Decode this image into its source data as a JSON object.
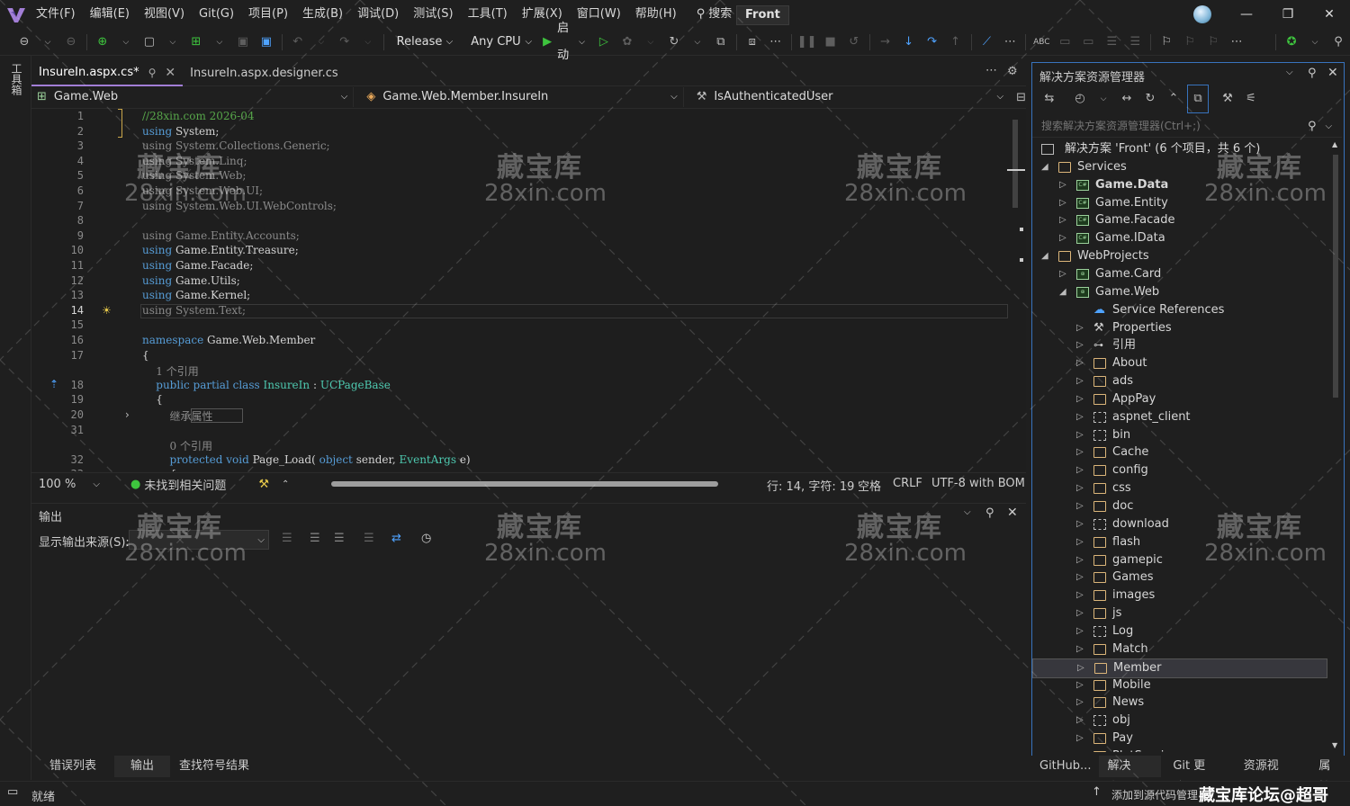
{
  "menubar": {
    "items": [
      "文件(F)",
      "编辑(E)",
      "视图(V)",
      "Git(G)",
      "项目(P)",
      "生成(B)",
      "调试(D)",
      "测试(S)",
      "工具(T)",
      "扩展(X)",
      "窗口(W)",
      "帮助(H)"
    ],
    "search_label": "搜索",
    "solution_name": "Front"
  },
  "toolbar": {
    "config": "Release",
    "platform": "Any CPU",
    "start_label": "启动"
  },
  "leftstrip": {
    "toolbox_label": "工具箱"
  },
  "doc_tabs": [
    {
      "label": "InsureIn.aspx.cs*",
      "active": true
    },
    {
      "label": "InsureIn.aspx.designer.cs",
      "active": false
    }
  ],
  "navbar": {
    "project": "Game.Web",
    "class": "Game.Web.Member.InsureIn",
    "member": "IsAuthenticatedUser"
  },
  "editor": {
    "lines": [
      {
        "n": "1",
        "segs": [
          [
            "cm",
            "//28xin.com 2026-04"
          ]
        ]
      },
      {
        "n": "2",
        "segs": [
          [
            "kw",
            "using"
          ],
          [
            "",
            "System;"
          ]
        ]
      },
      {
        "n": "3",
        "segs": [
          [
            "gr",
            "using"
          ],
          [
            "gr",
            "System.Collections.Generic;"
          ]
        ]
      },
      {
        "n": "4",
        "segs": [
          [
            "gr",
            "using"
          ],
          [
            "gr",
            "System.Linq;"
          ]
        ]
      },
      {
        "n": "5",
        "segs": [
          [
            "gr",
            "using"
          ],
          [
            "gr",
            "System.Web;"
          ]
        ]
      },
      {
        "n": "6",
        "segs": [
          [
            "gr",
            "using"
          ],
          [
            "gr",
            "System.Web.UI;"
          ]
        ]
      },
      {
        "n": "7",
        "segs": [
          [
            "gr",
            "using"
          ],
          [
            "gr",
            "System.Web.UI.WebControls;"
          ]
        ]
      },
      {
        "n": "8",
        "segs": []
      },
      {
        "n": "9",
        "segs": [
          [
            "gr",
            "using"
          ],
          [
            "gr",
            "Game.Entity.Accounts;"
          ]
        ]
      },
      {
        "n": "10",
        "segs": [
          [
            "kw",
            "using"
          ],
          [
            "",
            "Game.Entity.Treasure;"
          ]
        ]
      },
      {
        "n": "11",
        "segs": [
          [
            "kw",
            "using"
          ],
          [
            "",
            "Game.Facade;"
          ]
        ]
      },
      {
        "n": "12",
        "segs": [
          [
            "kw",
            "using"
          ],
          [
            "",
            "Game.Utils;"
          ]
        ]
      },
      {
        "n": "13",
        "segs": [
          [
            "kw",
            "using"
          ],
          [
            "",
            "Game.Kernel;"
          ]
        ]
      },
      {
        "n": "14",
        "segs": [
          [
            "gr",
            "using"
          ],
          [
            "gr",
            "System.Text;"
          ]
        ]
      },
      {
        "n": "15",
        "segs": []
      },
      {
        "n": "16",
        "segs": [
          [
            "kw",
            "namespace"
          ],
          [
            "",
            "Game.Web.Member"
          ]
        ]
      },
      {
        "n": "17",
        "segs": [
          [
            "",
            "{"
          ]
        ]
      },
      {
        "n": "",
        "segs": [
          [
            "gr",
            "    1 个引用"
          ]
        ]
      },
      {
        "n": "18",
        "segs": [
          [
            "kw",
            "    public partial class"
          ],
          [
            "ty",
            "InsureIn"
          ],
          [
            "",
            ":"
          ],
          [
            "ty",
            "UCPageBase"
          ]
        ]
      },
      {
        "n": "19",
        "segs": [
          [
            "",
            "    {"
          ]
        ]
      },
      {
        "n": "20",
        "segs": [
          [
            "gr",
            "        继承属性"
          ]
        ]
      },
      {
        "n": "31",
        "segs": []
      },
      {
        "n": "",
        "segs": [
          [
            "gr",
            "        0 个引用"
          ]
        ]
      },
      {
        "n": "32",
        "segs": [
          [
            "kw",
            "        protected void"
          ],
          [
            "",
            "Page_Load("
          ],
          [
            "kw",
            "object"
          ],
          [
            "",
            "sender,"
          ],
          [
            "ty",
            "EventArgs"
          ],
          [
            "",
            "e)"
          ]
        ]
      },
      {
        "n": "33",
        "segs": [
          [
            "",
            "        {"
          ]
        ]
      }
    ]
  },
  "edstatus": {
    "zoom": "100 %",
    "issues": "未找到相关问题",
    "position": "行: 14, 字符: 19",
    "whitespace": "空格",
    "eol": "CRLF",
    "encoding": "UTF-8 with BOM"
  },
  "output": {
    "title": "输出",
    "source_label": "显示输出来源(S):"
  },
  "bottom_tabs": [
    "错误列表",
    "输出",
    "查找符号结果"
  ],
  "solution_explorer": {
    "title": "解决方案资源管理器",
    "search_placeholder": "搜索解决方案资源管理器(Ctrl+;)",
    "rows": [
      {
        "label": "解决方案 'Front' (6 个项目，共 6 个)",
        "level": 0,
        "icon": "solution",
        "arrow": ""
      },
      {
        "label": "Services",
        "level": 1,
        "icon": "folder",
        "arrow": "open"
      },
      {
        "label": "Game.Data",
        "level": 2,
        "icon": "csproj",
        "arrow": "closed",
        "bold": true
      },
      {
        "label": "Game.Entity",
        "level": 2,
        "icon": "csproj",
        "arrow": "closed"
      },
      {
        "label": "Game.Facade",
        "level": 2,
        "icon": "csproj",
        "arrow": "closed"
      },
      {
        "label": "Game.IData",
        "level": 2,
        "icon": "csproj",
        "arrow": "closed"
      },
      {
        "label": "WebProjects",
        "level": 1,
        "icon": "folder",
        "arrow": "open"
      },
      {
        "label": "Game.Card",
        "level": 2,
        "icon": "webproj",
        "arrow": "closed"
      },
      {
        "label": "Game.Web",
        "level": 2,
        "icon": "webproj",
        "arrow": "open"
      },
      {
        "label": "Service References",
        "level": 3,
        "icon": "service",
        "arrow": ""
      },
      {
        "label": "Properties",
        "level": 3,
        "icon": "wrench",
        "arrow": "closed"
      },
      {
        "label": "引用",
        "level": 3,
        "icon": "refs",
        "arrow": "closed"
      },
      {
        "label": "About",
        "level": 3,
        "icon": "folder",
        "arrow": "closed"
      },
      {
        "label": "ads",
        "level": 3,
        "icon": "folder",
        "arrow": "closed"
      },
      {
        "label": "AppPay",
        "level": 3,
        "icon": "folder",
        "arrow": "closed"
      },
      {
        "label": "aspnet_client",
        "level": 3,
        "icon": "dashed",
        "arrow": "closed"
      },
      {
        "label": "bin",
        "level": 3,
        "icon": "dashed",
        "arrow": "closed"
      },
      {
        "label": "Cache",
        "level": 3,
        "icon": "folder",
        "arrow": "closed"
      },
      {
        "label": "config",
        "level": 3,
        "icon": "folder",
        "arrow": "closed"
      },
      {
        "label": "css",
        "level": 3,
        "icon": "folder",
        "arrow": "closed"
      },
      {
        "label": "doc",
        "level": 3,
        "icon": "folder",
        "arrow": "closed"
      },
      {
        "label": "download",
        "level": 3,
        "icon": "dashed",
        "arrow": "closed"
      },
      {
        "label": "flash",
        "level": 3,
        "icon": "folder",
        "arrow": "closed"
      },
      {
        "label": "gamepic",
        "level": 3,
        "icon": "folder",
        "arrow": "closed"
      },
      {
        "label": "Games",
        "level": 3,
        "icon": "folder",
        "arrow": "closed"
      },
      {
        "label": "images",
        "level": 3,
        "icon": "folder",
        "arrow": "closed"
      },
      {
        "label": "js",
        "level": 3,
        "icon": "folder",
        "arrow": "closed"
      },
      {
        "label": "Log",
        "level": 3,
        "icon": "dashed",
        "arrow": "closed"
      },
      {
        "label": "Match",
        "level": 3,
        "icon": "folder",
        "arrow": "closed"
      },
      {
        "label": "Member",
        "level": 3,
        "icon": "folder",
        "arrow": "closed",
        "selected": true
      },
      {
        "label": "Mobile",
        "level": 3,
        "icon": "folder",
        "arrow": "closed"
      },
      {
        "label": "News",
        "level": 3,
        "icon": "folder",
        "arrow": "closed"
      },
      {
        "label": "obj",
        "level": 3,
        "icon": "dashed",
        "arrow": "closed"
      },
      {
        "label": "Pay",
        "level": 3,
        "icon": "folder",
        "arrow": "closed"
      },
      {
        "label": "PlatService",
        "level": 3,
        "icon": "folder",
        "arrow": "closed"
      }
    ],
    "bottom_tabs": [
      "GitHub...",
      "解决方...",
      "Git 更改",
      "资源视图",
      "属性"
    ]
  },
  "statusbar": {
    "ready": "就绪",
    "source_control": "添加到源代码管理",
    "right_text": "藏宝库论坛@超哥"
  },
  "watermark": {
    "line1": "藏宝库",
    "line2": "28xin.com"
  },
  "colors": {
    "accent": "#a27ed6",
    "selection_border": "#3873bd",
    "keyword": "#569cd6",
    "comment": "#57a64a",
    "type": "#4ec9b0"
  }
}
